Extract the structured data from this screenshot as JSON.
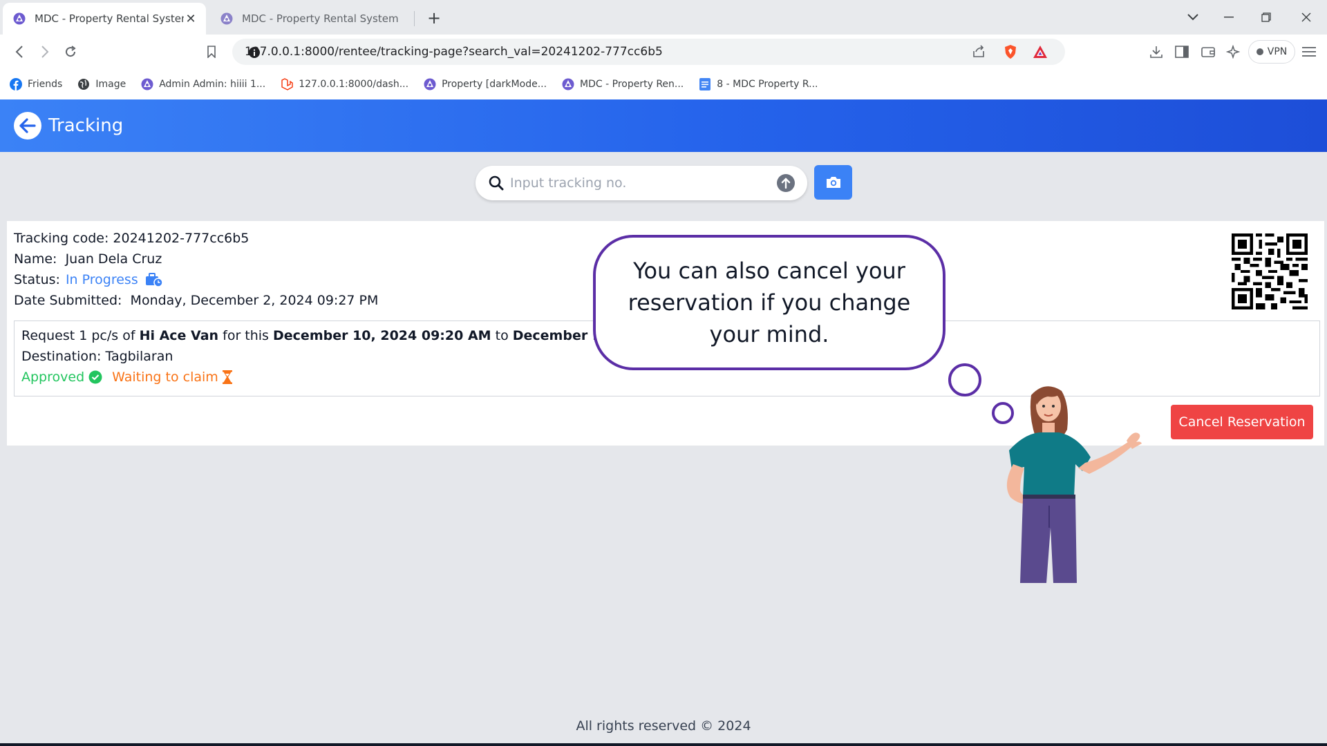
{
  "browser": {
    "tabs": [
      {
        "title": "MDC - Property Rental System",
        "active": true
      },
      {
        "title": "MDC - Property Rental System",
        "active": false
      }
    ],
    "url": "127.0.0.1:8000/rentee/tracking-page?search_val=20241202-777cc6b5",
    "vpn_label": "VPN",
    "bookmarks": [
      {
        "label": "Friends",
        "icon": "facebook-icon"
      },
      {
        "label": "Image",
        "icon": "globe-icon"
      },
      {
        "label": "Admin Admin: hiiii 1...",
        "icon": "app-logo-icon"
      },
      {
        "label": "127.0.0.1:8000/dash...",
        "icon": "laravel-icon"
      },
      {
        "label": "Property [darkMode...",
        "icon": "app-logo-icon"
      },
      {
        "label": "MDC - Property Ren...",
        "icon": "app-logo-icon"
      },
      {
        "label": "8 - MDC Property R...",
        "icon": "docs-icon"
      }
    ]
  },
  "header": {
    "title": "Tracking"
  },
  "search": {
    "placeholder": "Input tracking no."
  },
  "tracking": {
    "code_label": "Tracking code:",
    "code": "20241202-777cc6b5",
    "name_label": "Name:",
    "name": "Juan Dela Cruz",
    "status_label": "Status:",
    "status": "In Progress",
    "date_label": "Date Submitted:",
    "date": "Monday, December 2, 2024 09:27 PM"
  },
  "request": {
    "prefix": "Request 1 pc/s of",
    "item": "Hi Ace Van",
    "mid": "for this",
    "from": "December 10, 2024 09:20 AM",
    "to_word": "to",
    "to": "December 10, 2024",
    "destination_label": "Destination:",
    "destination": "Tagbilaran",
    "approved": "Approved",
    "waiting": "Waiting to claim"
  },
  "actions": {
    "cancel": "Cancel Reservation"
  },
  "tutorial": {
    "text": "You can also cancel your reservation if you change your mind."
  },
  "footer": {
    "text": "All rights reserved © 2024"
  },
  "colors": {
    "header": "#2563eb",
    "accent": "#3b82f6",
    "danger": "#ef4444",
    "success": "#22c55e",
    "warning": "#f97316",
    "bubble_border": "#5b2ea6"
  }
}
